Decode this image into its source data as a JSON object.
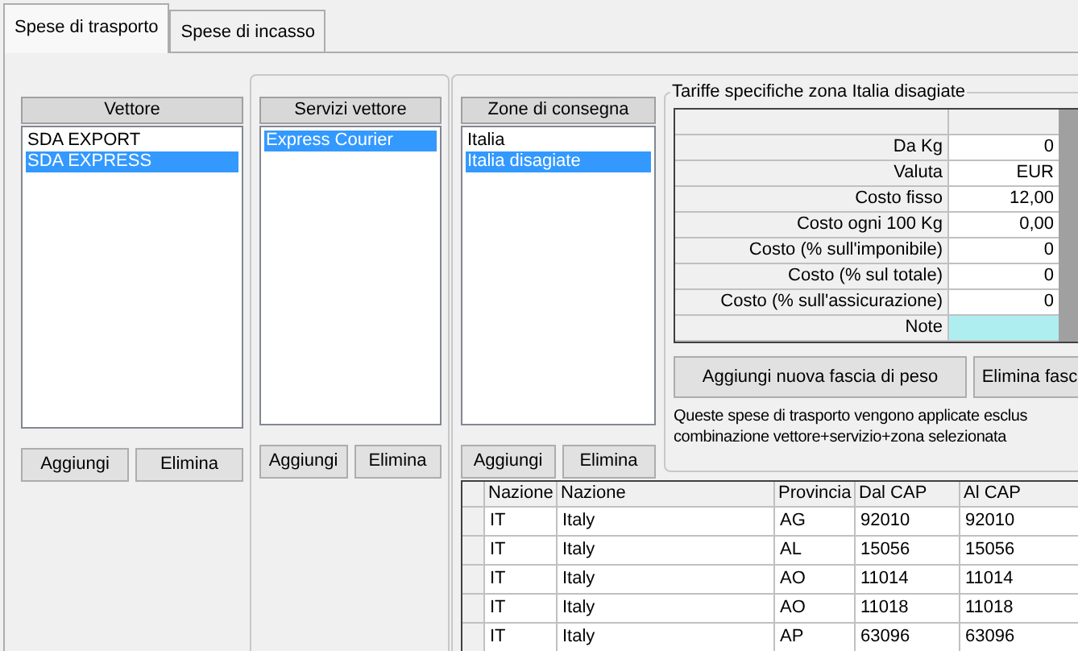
{
  "tabs": [
    {
      "label": "Spese di trasporto",
      "selected": true
    },
    {
      "label": "Spese di incasso",
      "selected": false
    }
  ],
  "carriers": {
    "header": "Vettore",
    "items": [
      {
        "label": "SDA EXPORT",
        "selected": false
      },
      {
        "label": "SDA EXPRESS",
        "selected": true
      }
    ],
    "buttons": [
      "Aggiungi",
      "Elimina"
    ]
  },
  "services": {
    "header": "Servizi vettore",
    "items": [
      {
        "label": "Express Courier",
        "selected": true
      }
    ],
    "buttons": [
      "Aggiungi",
      "Elimina"
    ]
  },
  "zones": {
    "header": "Zone di consegna",
    "items": [
      {
        "label": "Italia",
        "selected": false
      },
      {
        "label": "Italia disagiate",
        "selected": true
      }
    ],
    "buttons": [
      "Aggiungi",
      "Elimina"
    ]
  },
  "tariffs": {
    "title": "Tariffe specifiche zona Italia disagiate",
    "rows": [
      {
        "label": "Da Kg",
        "value": "0",
        "selected": false
      },
      {
        "label": "Valuta",
        "value": "EUR",
        "selected": false
      },
      {
        "label": "Costo fisso",
        "value": "12,00",
        "selected": false
      },
      {
        "label": "Costo ogni 100 Kg",
        "value": "0,00",
        "selected": false
      },
      {
        "label": "Costo (% sull'imponibile)",
        "value": "0",
        "selected": false
      },
      {
        "label": "Costo (% sul totale)",
        "value": "0",
        "selected": false
      },
      {
        "label": "Costo (% sull'assicurazione)",
        "value": "0",
        "selected": false
      },
      {
        "label": "Note",
        "value": "",
        "selected": true
      }
    ],
    "buttons": [
      "Aggiungi nuova fascia di peso",
      "Elimina fasc"
    ],
    "note": "Queste spese di trasporto vengono applicate esclus",
    "note_2": "combinazione vettore+servizio+zona selezionata"
  },
  "zone_table": {
    "columns": [
      "Nazione",
      "Nazione",
      "Provincia",
      "Dal CAP",
      "Al CAP"
    ],
    "rows": [
      [
        "IT",
        "Italy",
        "AG",
        "92010",
        "92010"
      ],
      [
        "IT",
        "Italy",
        "AL",
        "15056",
        "15056"
      ],
      [
        "IT",
        "Italy",
        "AO",
        "11014",
        "11014"
      ],
      [
        "IT",
        "Italy",
        "AO",
        "11018",
        "11018"
      ],
      [
        "IT",
        "Italy",
        "AP",
        "63096",
        "63096"
      ]
    ]
  }
}
